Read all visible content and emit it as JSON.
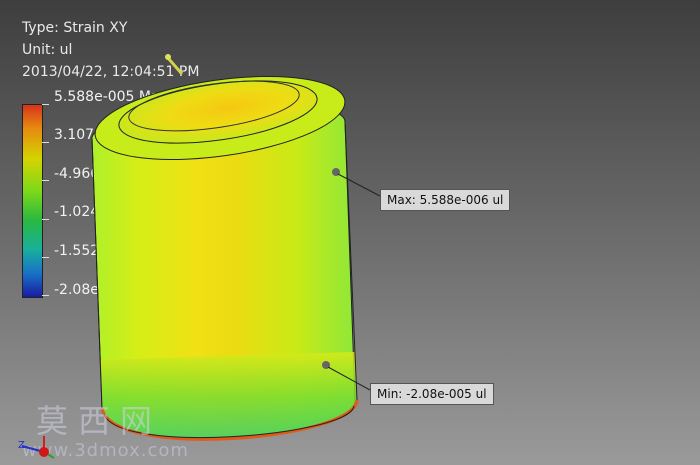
{
  "result_info": {
    "type_line": "Type: Strain XY",
    "unit_line": "Unit: ul",
    "timestamp": "2013/04/22, 12:04:51 PM"
  },
  "legend": {
    "max_label": "5.588e-005 Max",
    "labels": [
      "3.107e-007",
      "-4.966e-006",
      "-1.024e-005",
      "-1.552e-005"
    ],
    "min_label": "-2.08e-005 Min",
    "colors": [
      "#e0401a",
      "#c8c800",
      "#4fc83a",
      "#22b068",
      "#1a9ab8",
      "#1a2aa8"
    ]
  },
  "probes": {
    "max": "Max: 5.588e-006 ul",
    "min": "Min: -2.08e-005 ul"
  },
  "watermark": {
    "text": "莫西网",
    "url": "www.3dmox.com"
  },
  "model": {
    "part": "cylinder-cup",
    "primary_color": "#dfe515",
    "edge_color": "#9ef02c"
  }
}
